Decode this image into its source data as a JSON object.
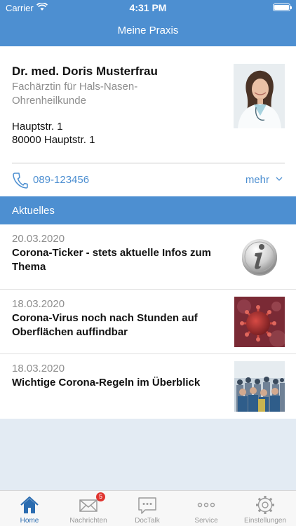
{
  "status_bar": {
    "carrier": "Carrier",
    "time": "4:31 PM"
  },
  "header": {
    "title": "Meine Praxis"
  },
  "doctor": {
    "name": "Dr. med. Doris Musterfrau",
    "specialty": "Fachärztin für Hals-Nasen-Ohrenheilkunde",
    "street": "Hauptstr. 1",
    "city": "80000 Hauptstr. 1",
    "phone": "089-123456",
    "more_label": "mehr"
  },
  "news_section": {
    "title": "Aktuelles",
    "items": [
      {
        "date": "20.03.2020",
        "title": "Corona-Ticker - stets aktuelle Infos zum Thema",
        "icon": "info-icon"
      },
      {
        "date": "18.03.2020",
        "title": "Corona-Virus noch nach Stunden auf Oberflächen auffindbar",
        "icon": "virus-image"
      },
      {
        "date": "18.03.2020",
        "title": "Wichtige Corona-Regeln im Überblick",
        "icon": "crowd-image"
      }
    ]
  },
  "tabs": [
    {
      "label": "Home",
      "icon": "home-icon",
      "active": true
    },
    {
      "label": "Nachrichten",
      "icon": "mail-icon",
      "badge": "5"
    },
    {
      "label": "DocTalk",
      "icon": "chat-icon"
    },
    {
      "label": "Service",
      "icon": "more-dots-icon"
    },
    {
      "label": "Einstellungen",
      "icon": "gear-icon"
    }
  ],
  "colors": {
    "brand": "#4d8fd1",
    "badge": "#e0342f",
    "background": "#e3ebf3"
  }
}
